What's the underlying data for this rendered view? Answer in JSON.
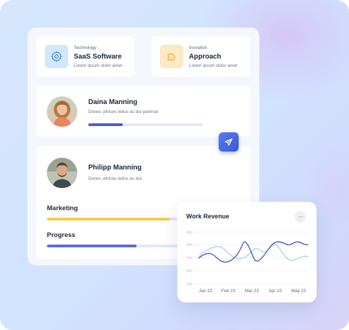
{
  "cards": [
    {
      "category": "Technology",
      "title": "SaaS Software",
      "subtitle": "Lorem ipsum dolor amet",
      "icon": "gear-icon",
      "color": "#d3e7fc"
    },
    {
      "category": "Inovation",
      "title": "Approach",
      "subtitle": "Lorem ipsum dolor amet",
      "icon": "puzzle-icon",
      "color": "#fbe8c4"
    }
  ],
  "profiles": [
    {
      "name": "Daina Manning",
      "description": "Donec ultrices tellus ac dui pulvinar",
      "progress": 0.3
    },
    {
      "name": "Philipp Manning",
      "description": "Donec ultrices tellus ac dui"
    }
  ],
  "bars": [
    {
      "label": "Marketing",
      "progress": 0.85,
      "color": "#f6ca4a"
    },
    {
      "label": "Progress",
      "progress": 0.62,
      "color": "#5b6bdc"
    }
  ],
  "revenue": {
    "title": "Work Revenue",
    "more_label": "···",
    "months": [
      "Jan 23",
      "Feb 23",
      "Mar 23",
      "Apr 23",
      "May 23"
    ]
  },
  "colors": {
    "accent": "#4a5bd8",
    "series_primary": "#4a58c9",
    "series_secondary": "#a5d4ec"
  }
}
